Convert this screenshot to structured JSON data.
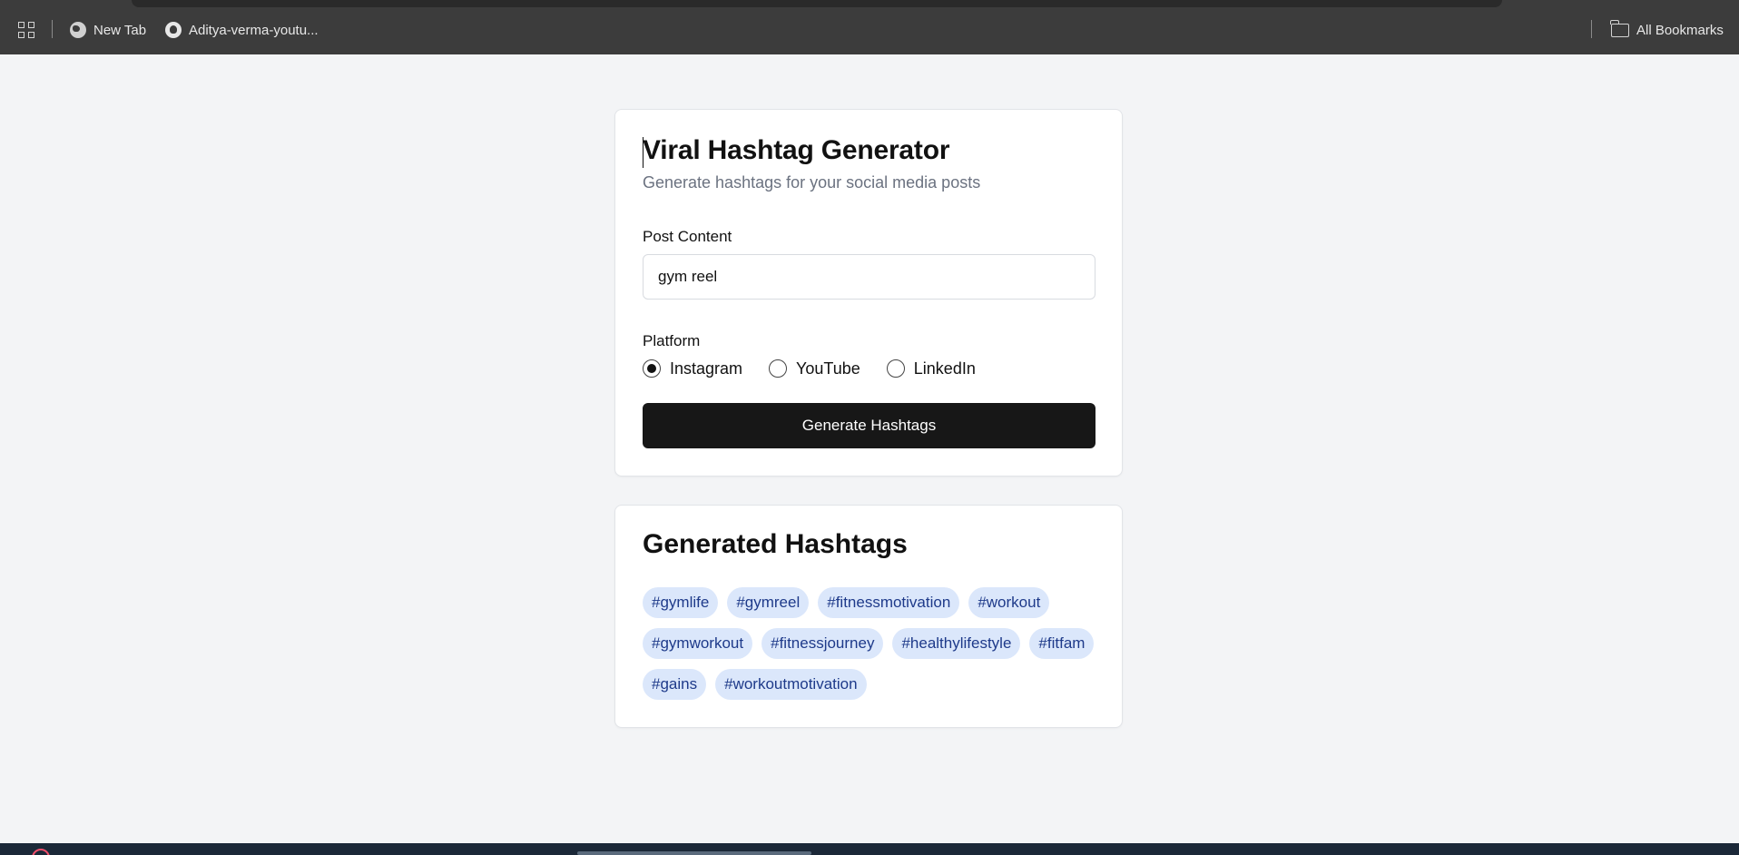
{
  "bookmarks_bar": {
    "items": [
      {
        "label": "New Tab",
        "icon": "globe-icon"
      },
      {
        "label": "Aditya-verma-youtu...",
        "icon": "github-icon"
      }
    ],
    "all_bookmarks_label": "All Bookmarks"
  },
  "form": {
    "title": "Viral Hashtag Generator",
    "subtitle": "Generate hashtags for your social media posts",
    "post_content_label": "Post Content",
    "post_content_value": "gym reel",
    "platform_label": "Platform",
    "platforms": [
      {
        "label": "Instagram",
        "selected": true
      },
      {
        "label": "YouTube",
        "selected": false
      },
      {
        "label": "LinkedIn",
        "selected": false
      }
    ],
    "generate_button_label": "Generate Hashtags"
  },
  "results": {
    "title": "Generated Hashtags",
    "hashtags": [
      "#gymlife",
      "#gymreel",
      "#fitnessmotivation",
      "#workout",
      "#gymworkout",
      "#fitnessjourney",
      "#healthylifestyle",
      "#fitfam",
      "#gains",
      "#workoutmotivation"
    ]
  },
  "colors": {
    "page_background": "#f3f4f6",
    "button_background": "#171717",
    "tag_background": "#dbe7fb",
    "tag_text": "#1e3a8a"
  }
}
